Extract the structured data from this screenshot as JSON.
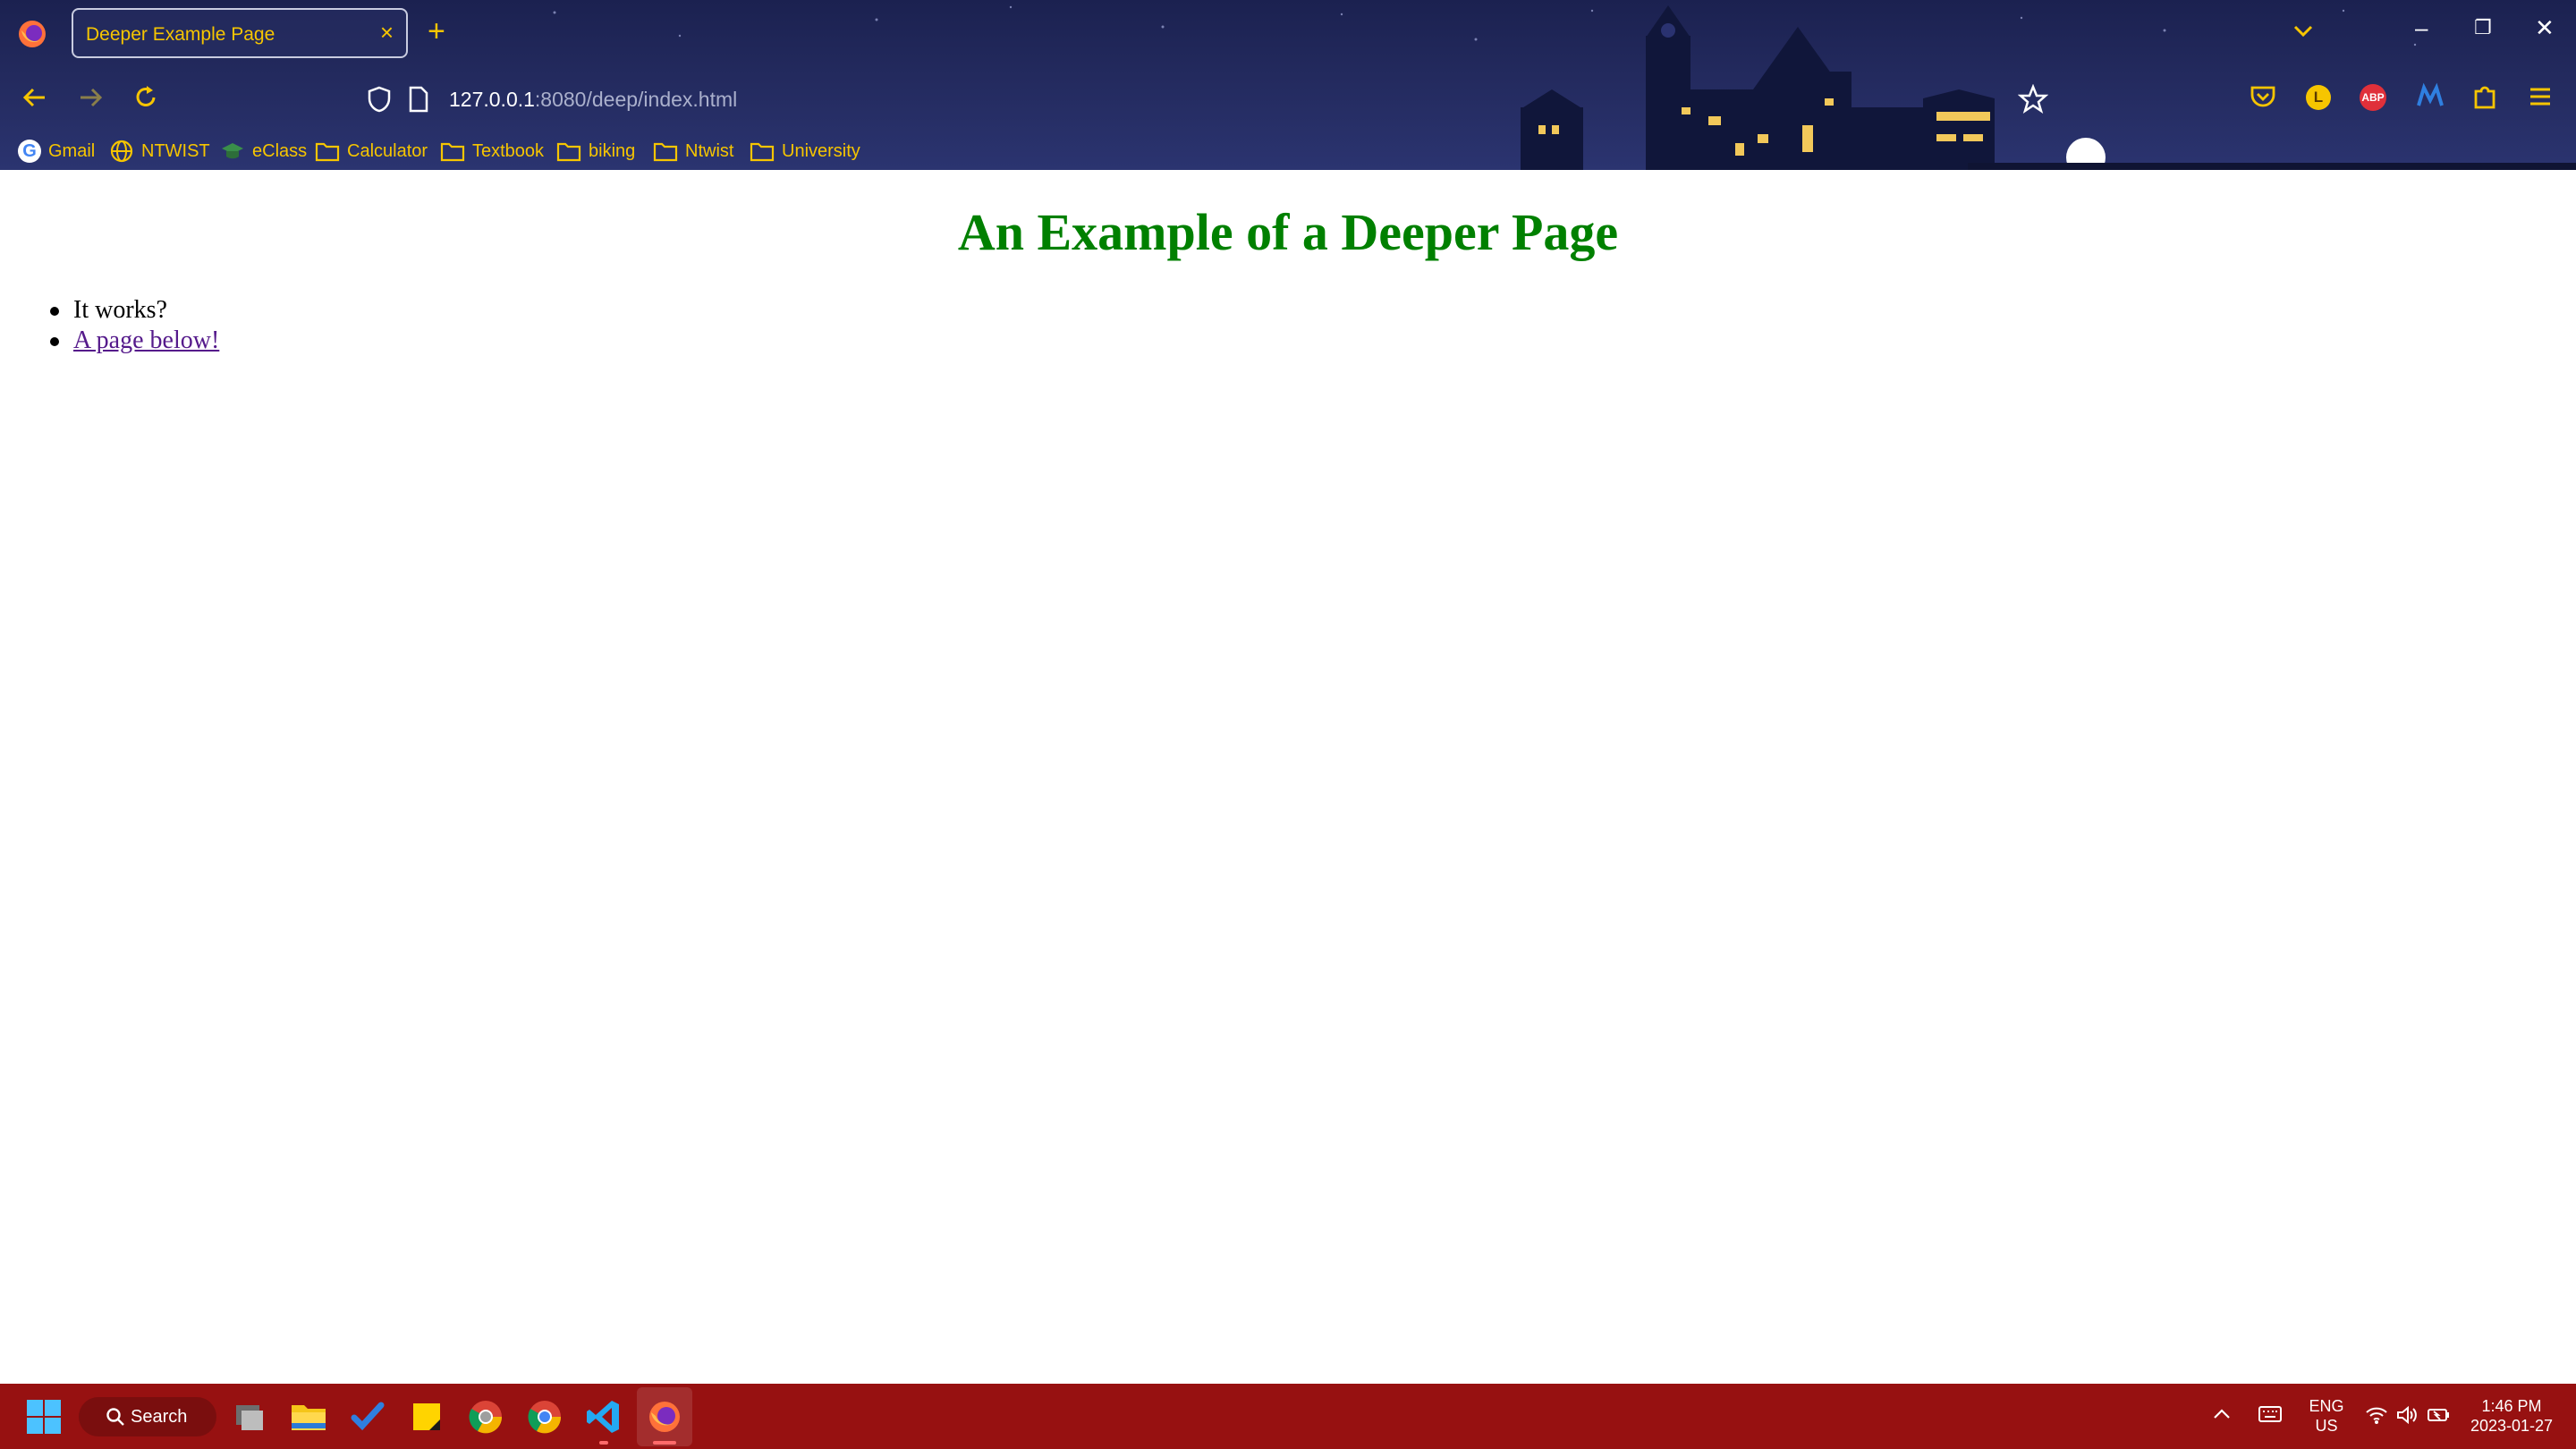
{
  "window": {
    "tab_title": "Deeper Example Page",
    "tab_close": "×",
    "new_tab": "+",
    "minimize": "–",
    "restore": "❐",
    "close": "✕"
  },
  "navbar": {
    "url_host": "127.0.0.1",
    "url_rest": ":8080/deep/index.html",
    "icons": [
      "back-icon",
      "forward-icon",
      "reload-icon",
      "shield-icon",
      "page-icon",
      "star-icon",
      "pocket-icon",
      "profile-icon",
      "adblock-icon",
      "extension-icon",
      "puzzle-icon",
      "menu-icon"
    ],
    "profile_letter": "L",
    "abp_label": "ABP"
  },
  "bookmarks": [
    {
      "label": "Gmail",
      "icon": "google-icon"
    },
    {
      "label": "NTWIST",
      "icon": "globe-icon"
    },
    {
      "label": "eClass",
      "icon": "mortarboard-icon"
    },
    {
      "label": "Calculator",
      "icon": "folder-icon"
    },
    {
      "label": "Textbook",
      "icon": "folder-icon"
    },
    {
      "label": "biking",
      "icon": "folder-icon"
    },
    {
      "label": "Ntwist",
      "icon": "folder-icon"
    },
    {
      "label": "University",
      "icon": "folder-icon"
    }
  ],
  "page": {
    "heading": "An Example of a Deeper Page",
    "items": [
      {
        "text": "It works?",
        "link": false
      },
      {
        "text": "A page below!",
        "link": true
      }
    ]
  },
  "taskbar": {
    "search_label": "Search",
    "apps": [
      "windows-start-icon",
      "task-view-icon",
      "file-explorer-icon",
      "todo-icon",
      "sticky-notes-icon",
      "chrome-dev-icon",
      "chrome-icon",
      "vscode-icon",
      "firefox-icon"
    ],
    "lang_line1": "ENG",
    "lang_line2": "US",
    "time": "1:46 PM",
    "date": "2023-01-27"
  },
  "colors": {
    "chrome_bg": "#1b2150",
    "accent_yellow": "#f6c500",
    "heading_green": "#008000",
    "taskbar_red": "#971111",
    "visited_link": "#551a8b"
  }
}
